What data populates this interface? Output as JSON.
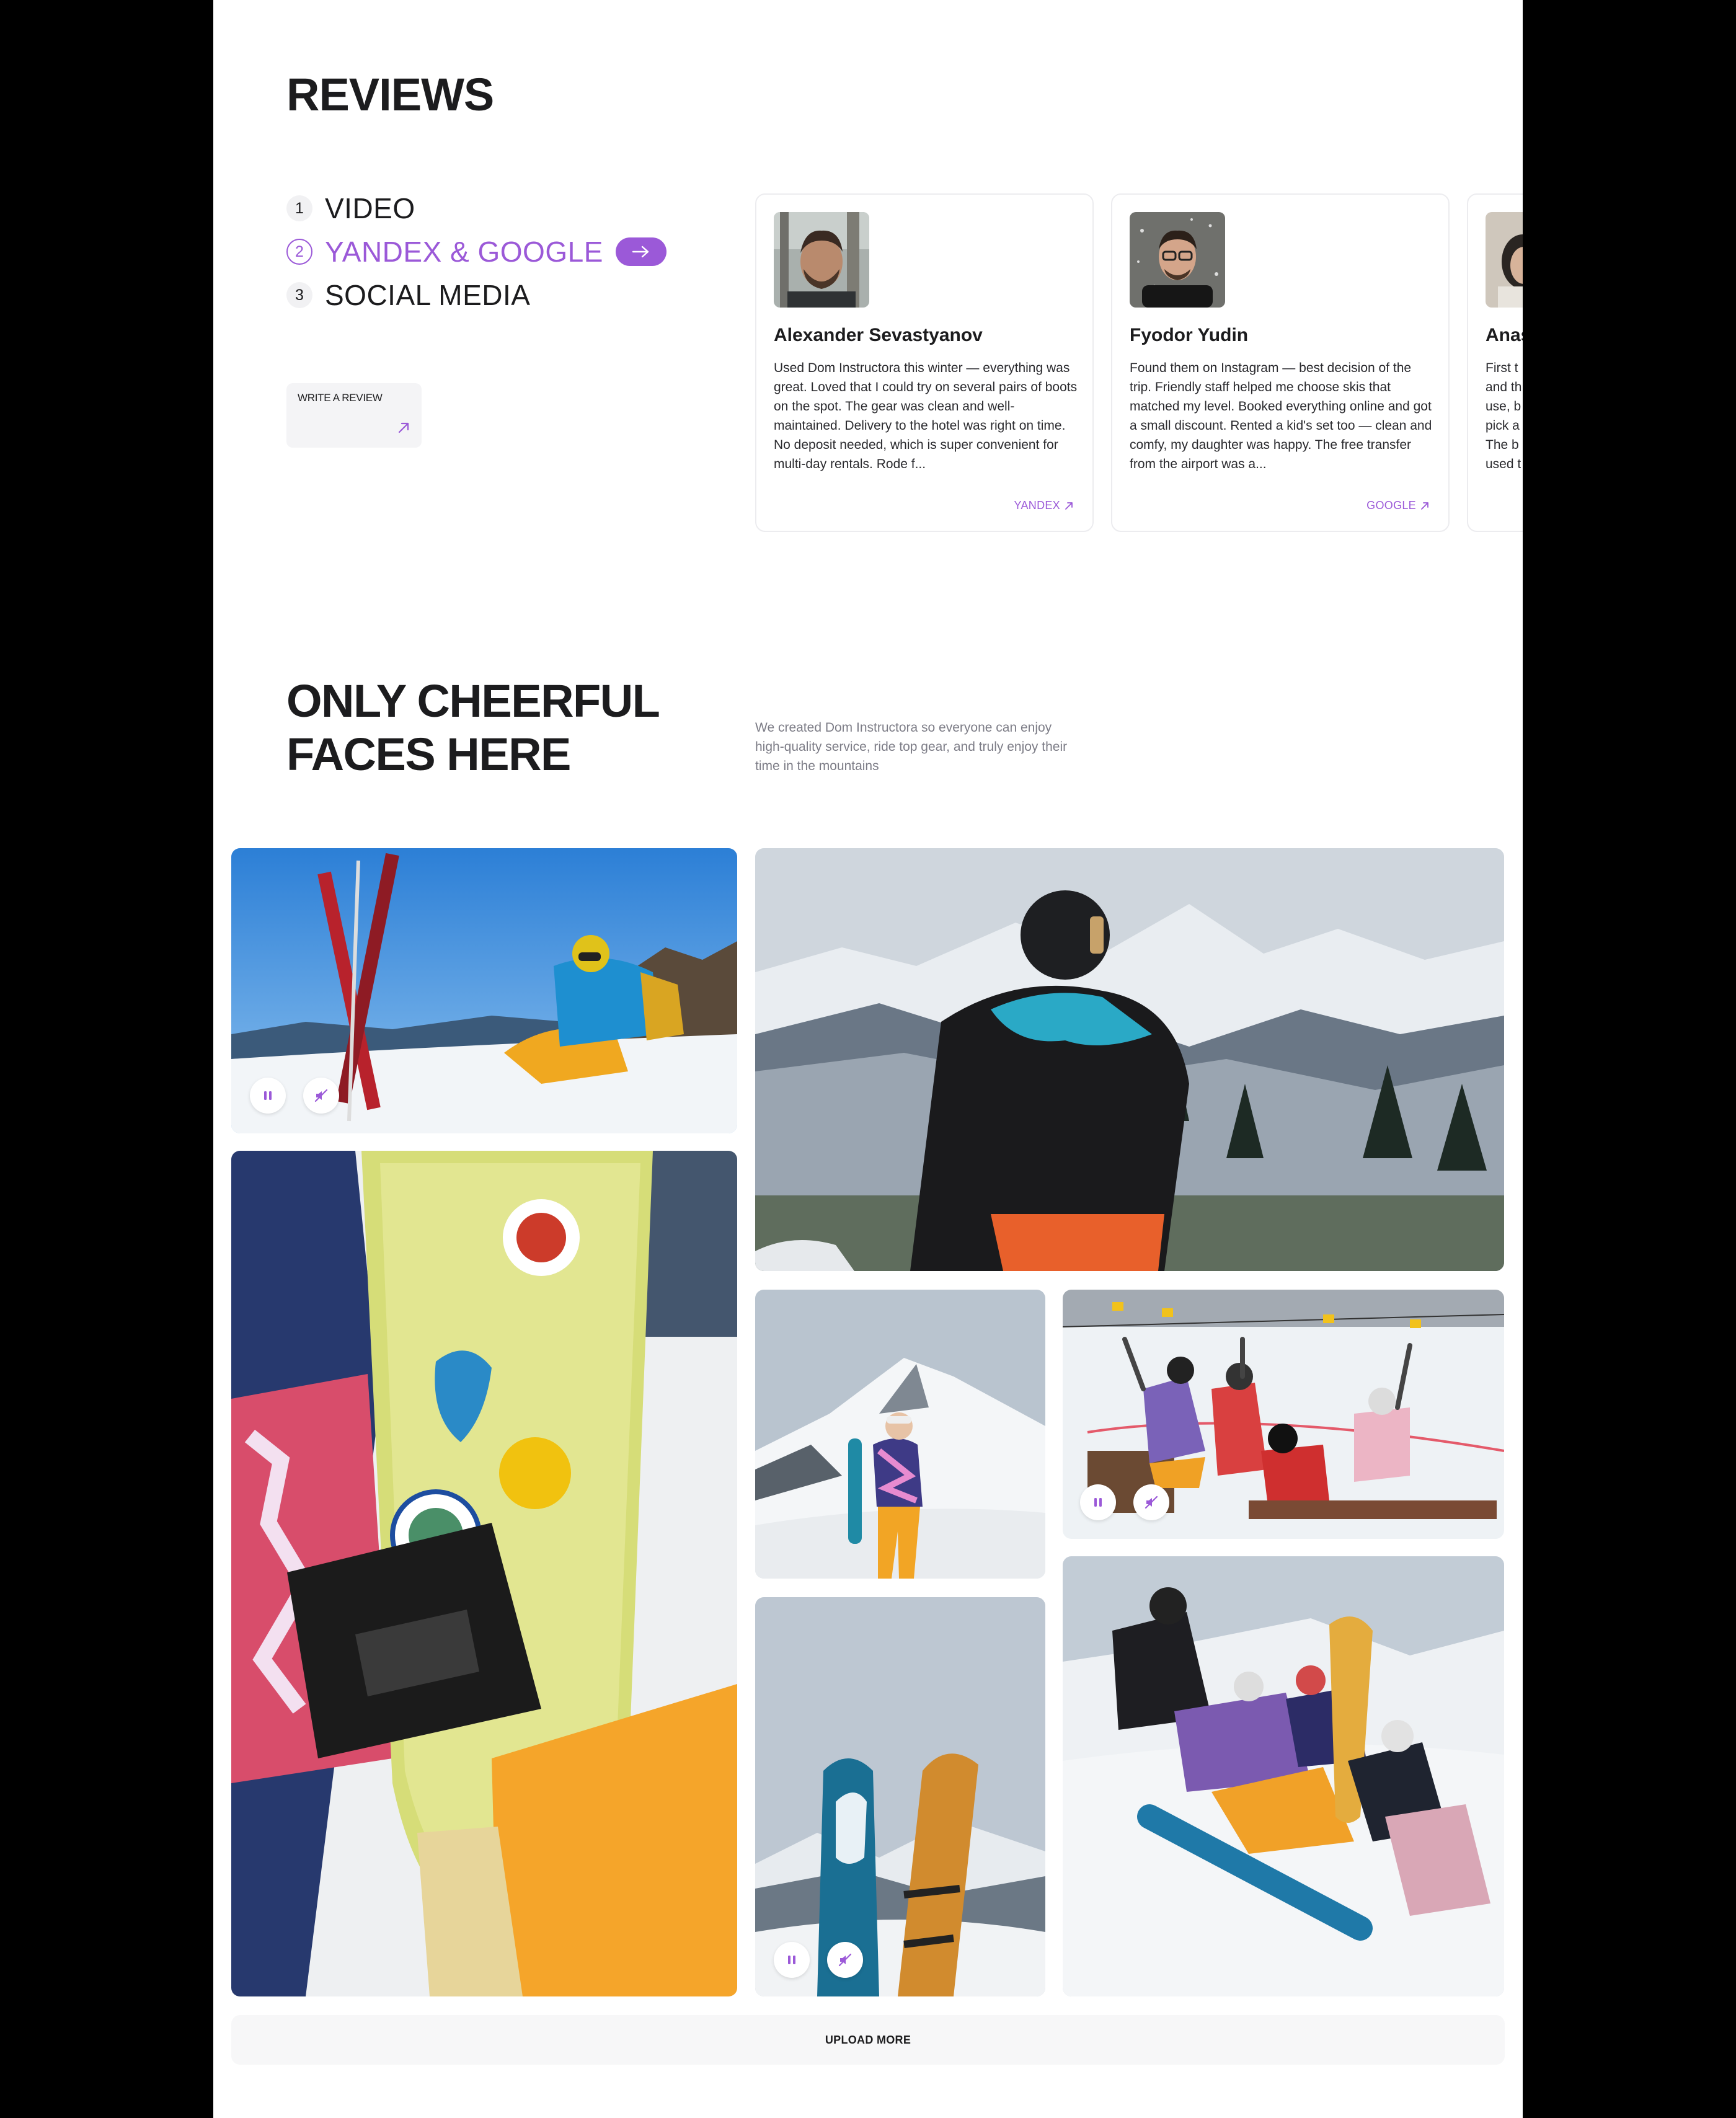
{
  "colors": {
    "accent": "#9b59d8",
    "text": "#1c1c1e",
    "muted": "#7c7c86",
    "card_border": "#ececef"
  },
  "reviews": {
    "title": "REVIEWS",
    "tabs": [
      {
        "num": "1",
        "label": "VIDEO",
        "active": false
      },
      {
        "num": "2",
        "label": "YANDEX & GOOGLE",
        "active": true,
        "icon": "arrow-right-icon"
      },
      {
        "num": "3",
        "label": "SOCIAL MEDIA",
        "active": false
      }
    ],
    "write_button": {
      "label": "WRITE A REVIEW",
      "icon": "arrow-up-right-icon"
    },
    "cards": [
      {
        "name": "Alexander Sevastyanov",
        "text": "Used Dom Instructora this winter — everything was great. Loved that I could try on several pairs of boots on the spot. The gear was clean and well-maintained. Delivery to the hotel was right on time. No deposit needed, which is super convenient for multi-day rentals. Rode f...",
        "source": "YANDEX"
      },
      {
        "name": "Fyodor Yudin",
        "text": "Found them on Instagram — best decision of the trip. Friendly staff helped me choose skis that matched my level. Booked everything online and got a small discount. Rented a kid's set too — clean and comfy, my daughter was happy. The free transfer from the airport was a...",
        "source": "GOOGLE"
      },
      {
        "name": "Anas",
        "text": "First t and th use, b pick a The b used t",
        "source": ""
      }
    ]
  },
  "cheerful": {
    "title_line1": "ONLY CHEERFUL",
    "title_line2": "FACES HERE",
    "description": "We created Dom Instructora so everyone can enjoy high-quality service, ride top gear, and truly enjoy their time in the mountains"
  },
  "gallery": {
    "controls": {
      "pause_icon": "pause-icon",
      "mute_icon": "sound-off-icon"
    },
    "upload_label": "UPLOAD MORE"
  }
}
